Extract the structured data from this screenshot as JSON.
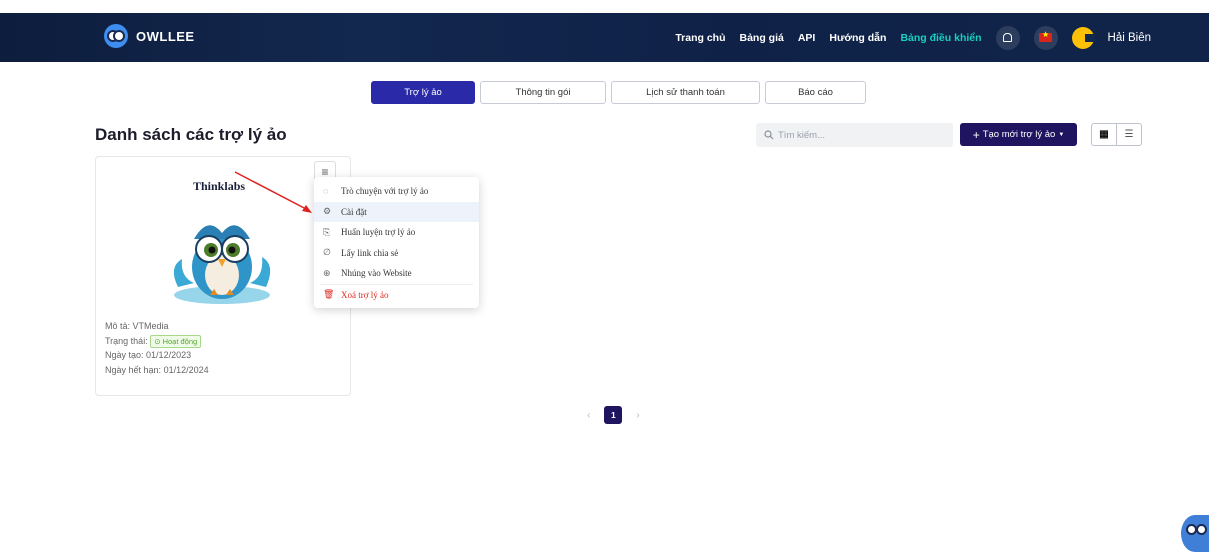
{
  "header": {
    "brand": "OWLLEE",
    "nav": [
      "Trang chủ",
      "Bảng giá",
      "API",
      "Hướng dẫn",
      "Bảng điều khiển"
    ],
    "user_name": "Hải Biên"
  },
  "tabs": [
    {
      "label": "Trợ lý ảo",
      "active": true
    },
    {
      "label": "Thông tin gói",
      "active": false
    },
    {
      "label": "Lịch sử thanh toán",
      "active": false
    },
    {
      "label": "Báo cáo",
      "active": false
    }
  ],
  "page_title": "Danh sách các trợ lý ảo",
  "search": {
    "placeholder": "Tìm kiếm..."
  },
  "create_button": "Tạo mới trợ lý ảo",
  "card": {
    "name": "Thinklabs",
    "description_label": "Mô tả:",
    "description_value": "VTMedia",
    "status_label": "Trạng thái:",
    "status_value": "Hoạt động",
    "created_label": "Ngày tạo:",
    "created_value": "01/12/2023",
    "expires_label": "Ngày hết hạn:",
    "expires_value": "01/12/2024"
  },
  "menu": [
    {
      "label": "Trò chuyện với trợ lý ảo",
      "icon": "chat-icon"
    },
    {
      "label": "Cài đặt",
      "icon": "gear-icon"
    },
    {
      "label": "Huấn luyện trợ lý ảo",
      "icon": "train-icon"
    },
    {
      "label": "Lấy link chia sẻ",
      "icon": "link-icon"
    },
    {
      "label": "Nhúng vào Website",
      "icon": "globe-icon"
    },
    {
      "label": "Xoá trợ lý ảo",
      "icon": "trash-icon"
    }
  ],
  "pagination": {
    "current": "1"
  },
  "colors": {
    "primary": "#2a2aa8",
    "dark_button": "#1e1460",
    "header": "#13284f",
    "danger": "#e0281f",
    "accent": "#18d0c0"
  }
}
